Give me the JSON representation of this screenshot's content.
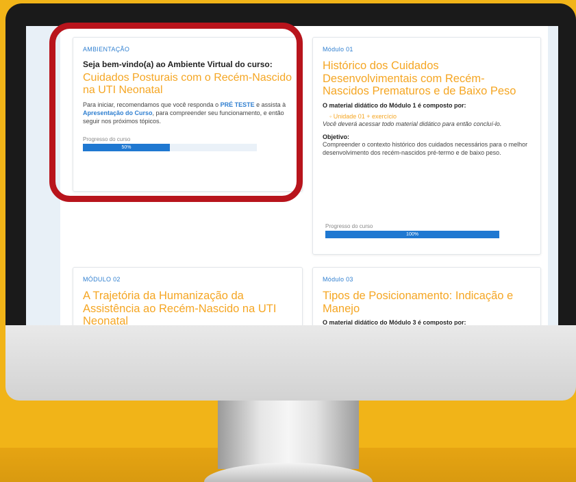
{
  "cards": {
    "ambientacao": {
      "label": "AMBIENTAÇÃO",
      "welcome": "Seja bem-vindo(a) ao Ambiente Virtual do curso:",
      "title": "Cuidados Posturais com o Recém-Nascido na UTI Neonatal",
      "text_1": "Para iniciar, recomendamos que você responda o ",
      "text_link_1": "PRÉ TESTE",
      "text_2": " e assista à ",
      "text_link_2": "Apresentação do Curso",
      "text_3": ", para compreender seu funcionamento, e então seguir nos próximos tópicos.",
      "progress_label": "Progresso do curso",
      "progress_text": "50%",
      "progress_value": 50
    },
    "modulo01": {
      "label": "Módulo 01",
      "title": "Histórico dos Cuidados Desenvolvimentais com Recém-Nascidos Prematuros e de Baixo Peso",
      "subhead": "O material didático do Módulo 1 é composto por:",
      "bullet": "Unidade 01 + exercício",
      "italic": "Você deverá acessar todo material didático para então concluí-lo.",
      "objective_head": "Objetivo:",
      "objective_text": "Compreender o contexto histórico dos cuidados necessários para o melhor desenvolvimento dos recém-nascidos pré-termo e de baixo peso.",
      "progress_label": "Progresso do curso",
      "progress_text": "100%",
      "progress_value": 100
    },
    "modulo02": {
      "label": "MÓDULO 02",
      "title": "A Trajetória da Humanização da Assistência ao Recém-Nascido na UTI Neonatal"
    },
    "modulo03": {
      "label": "Módulo 03",
      "title": "Tipos de Posicionamento: Indicação e Manejo",
      "subhead": "O material didático do Módulo 3 é composto por:"
    }
  },
  "colors": {
    "background": "#f1b418",
    "accent_orange": "#f5a623",
    "link_blue": "#2f7fd0",
    "progress_blue": "#1f78d1",
    "highlight_red": "#b8141c"
  }
}
